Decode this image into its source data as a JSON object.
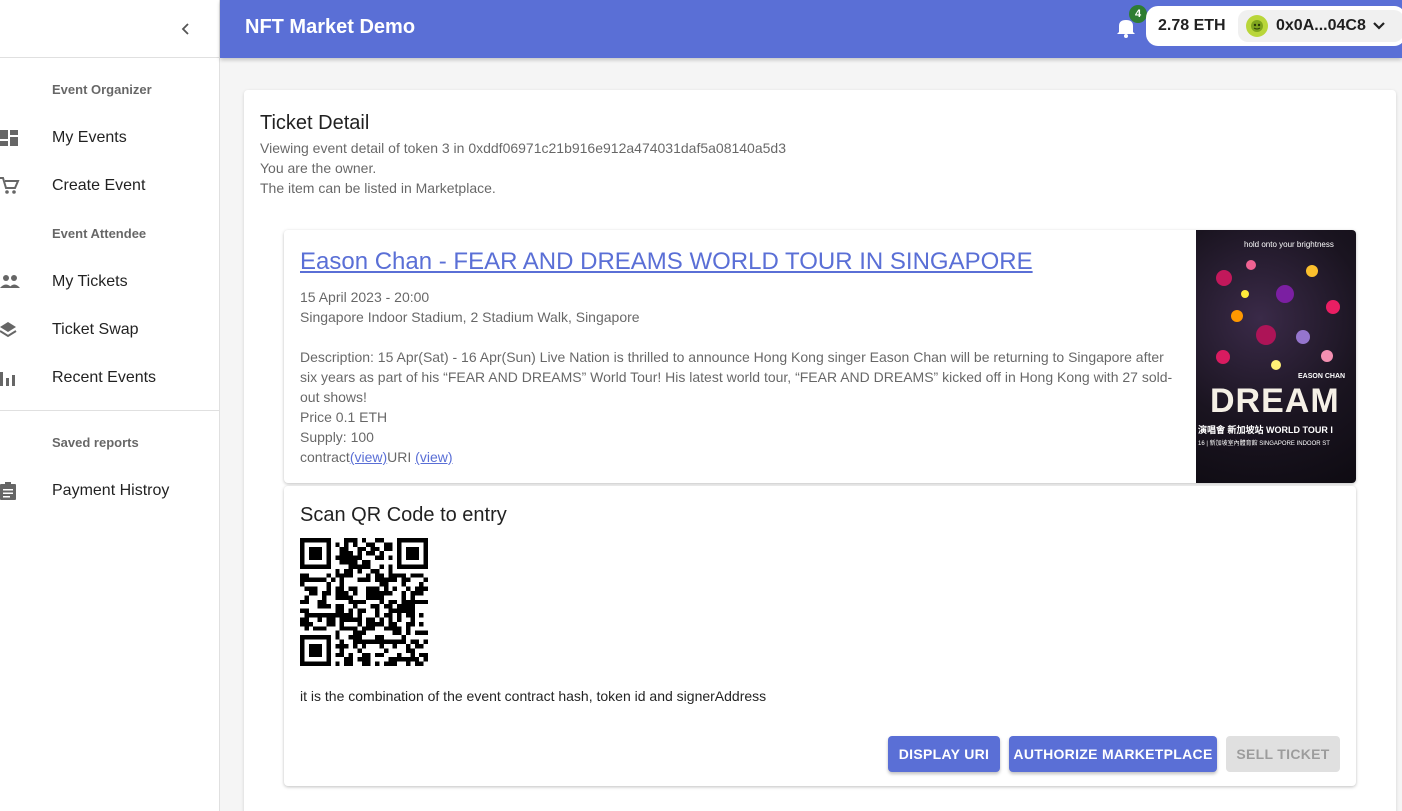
{
  "app": {
    "title": "NFT Market Demo"
  },
  "header": {
    "notification_count": "4",
    "eth_balance": "2.78 ETH",
    "account_address": "0x0A...04C8"
  },
  "sidebar": {
    "sections": [
      {
        "title": "Event Organizer"
      },
      {
        "title": "Event Attendee"
      },
      {
        "title": "Saved reports"
      }
    ],
    "items": [
      {
        "label": "My Events",
        "icon": "dashboard-icon"
      },
      {
        "label": "Create Event",
        "icon": "shopping-cart-icon"
      },
      {
        "label": "My Tickets",
        "icon": "people-icon"
      },
      {
        "label": "Ticket Swap",
        "icon": "layers-icon"
      },
      {
        "label": "Recent Events",
        "icon": "bar-chart-icon"
      },
      {
        "label": "Payment Histroy",
        "icon": "assignment-icon"
      }
    ]
  },
  "ticket": {
    "page_title": "Ticket Detail",
    "viewing_line": "Viewing event detail of token 3 in 0xddf06971c21b916e912a474031daf5a08140a5d3",
    "owner_line": "You are the owner.",
    "market_line": "The item can be listed in Marketplace."
  },
  "event": {
    "title": "Eason Chan - FEAR AND DREAMS WORLD TOUR IN SINGAPORE",
    "datetime": "15 April 2023 - 20:00",
    "venue": "Singapore Indoor Stadium, 2 Stadium Walk, Singapore",
    "description": "Description: 15 Apr(Sat) - 16 Apr(Sun) Live Nation is thrilled to announce Hong Kong singer Eason Chan will be returning to Singapore after six years as part of his “FEAR AND DREAMS” World Tour! His latest world tour, “FEAR AND DREAMS” kicked off in Hong Kong with 27 sold-out shows!",
    "price": "Price 0.1 ETH",
    "supply": "Supply: 100",
    "contract_label": "contract",
    "view_label": "(view)",
    "uri_label": "URI",
    "poster": {
      "tagline": "hold onto your brightness",
      "artist": "EASON CHAN",
      "headline": "DREAM",
      "subline": "演唱會 新加坡站 WORLD TOUR I",
      "venue_line": "16 | 新加坡室內體育館 SINGAPORE INDOOR ST"
    }
  },
  "qr_section": {
    "title": "Scan QR Code to entry",
    "note": "it is the combination of the event contract hash, token id and signerAddress"
  },
  "actions": {
    "display_uri": "DISPLAY URI",
    "authorize": "AUTHORIZE MARKETPLACE",
    "sell": "SELL TICKET"
  },
  "colors": {
    "primary": "#5a6fd6",
    "badge": "#2e7d32"
  }
}
